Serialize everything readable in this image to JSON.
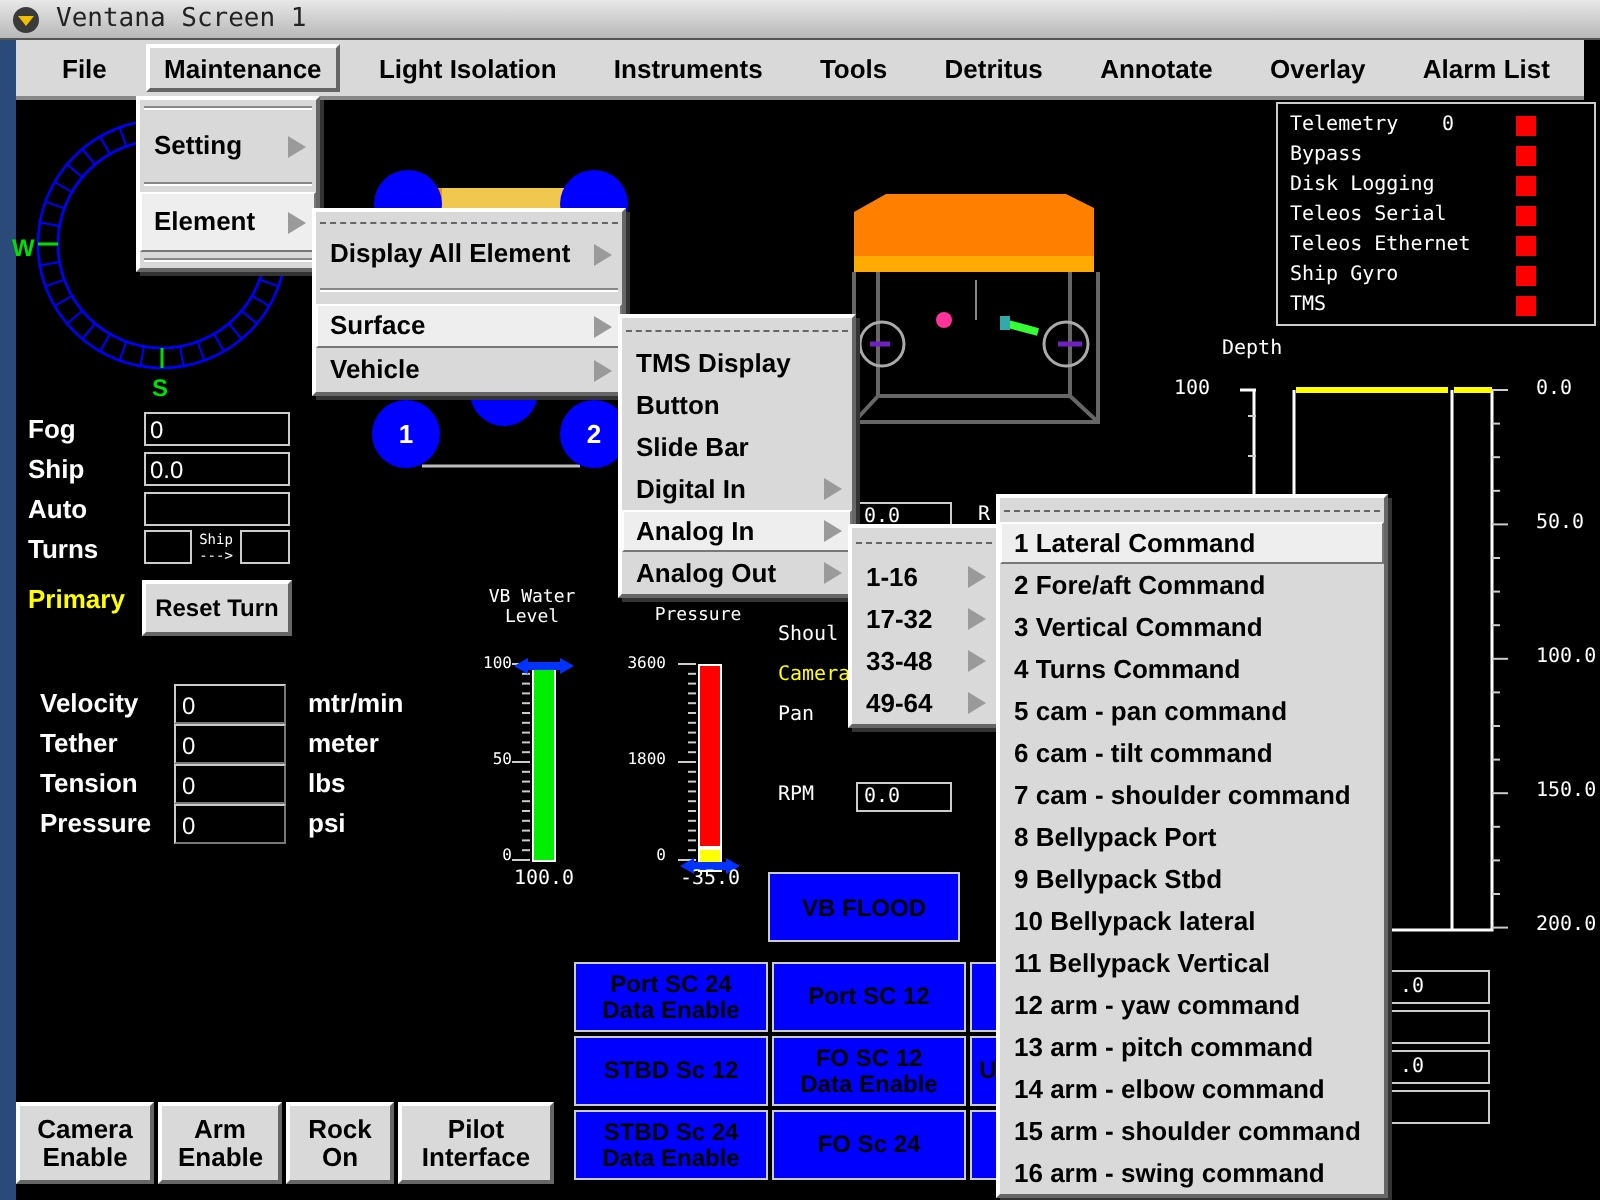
{
  "window": {
    "title": "Ventana Screen 1"
  },
  "menu_bar": [
    {
      "label": "File",
      "selected": false
    },
    {
      "label": "Maintenance",
      "selected": true
    },
    {
      "label": "Light Isolation",
      "selected": false
    },
    {
      "label": "Instruments",
      "selected": false
    },
    {
      "label": "Tools",
      "selected": false
    },
    {
      "label": "Detritus",
      "selected": false
    },
    {
      "label": "Annotate",
      "selected": false
    },
    {
      "label": "Overlay",
      "selected": false
    },
    {
      "label": "Alarm List",
      "selected": false
    }
  ],
  "compass": {
    "labels": [
      "W",
      "S"
    ]
  },
  "controls": [
    {
      "label": "Fog",
      "value": "0"
    },
    {
      "label": "Ship",
      "value": "0.0"
    },
    {
      "label": "Auto"
    }
  ],
  "turns": {
    "label": "Turns",
    "arrow_lines": [
      "Ship",
      "--->"
    ]
  },
  "primary": "Primary",
  "reset_button": "Reset Turn",
  "readouts": [
    {
      "label": "Velocity",
      "value": "0",
      "unit": "mtr/min"
    },
    {
      "label": "Tether",
      "value": "0",
      "unit": "meter"
    },
    {
      "label": "Tension",
      "value": "0",
      "unit": "lbs"
    },
    {
      "label": "Pressure",
      "value": "0",
      "unit": "psi"
    }
  ],
  "bottom_buttons": [
    "Camera Enable",
    "Arm Enable",
    "Rock On",
    "Pilot Interface"
  ],
  "thrusters": [
    "1",
    "2"
  ],
  "gauges": [
    {
      "title": "VB Water Level",
      "ticks": [
        "100",
        "50",
        "0"
      ],
      "reading": "100.0",
      "level": 1.0
    },
    {
      "title": "Pressure",
      "ticks": [
        "3600",
        "1800",
        "0"
      ],
      "reading": "-35.0",
      "level": 1.0
    }
  ],
  "vehicle_panel": {
    "labels": [
      {
        "text": "R",
        "highlight": false
      },
      {
        "text": "Shoul",
        "highlight": false
      },
      {
        "text": "Camera",
        "highlight": true
      },
      {
        "text": "Pan",
        "highlight": false
      },
      {
        "text": "RPM",
        "highlight": false
      }
    ],
    "fields": [
      "0.0",
      "0.0"
    ]
  },
  "vb_flood": "VB FLOOD",
  "sc_buttons": [
    {
      "kind": "labeled",
      "label": "Port SC 24 Data Enable"
    },
    {
      "kind": "labeled",
      "label": "Port SC 12"
    },
    {
      "kind": "blank"
    },
    {
      "kind": "labeled",
      "label": "STBD Sc 12"
    },
    {
      "kind": "labeled",
      "label": "FO SC 12 Data Enable"
    },
    {
      "kind": "labeled",
      "label": "U"
    },
    {
      "kind": "labeled",
      "label": "STBD Sc 24 Data Enable"
    },
    {
      "kind": "labeled",
      "label": "FO Sc 24"
    },
    {
      "kind": "blank"
    }
  ],
  "alarms": [
    {
      "label": "Telemetry",
      "value": "0",
      "color": "#ff0000"
    },
    {
      "label": "Bypass",
      "color": "#ff0000"
    },
    {
      "label": "Disk Logging",
      "color": "#ff0000"
    },
    {
      "label": "Teleos Serial",
      "color": "#ff0000"
    },
    {
      "label": "Teleos Ethernet",
      "color": "#ff0000"
    },
    {
      "label": "Ship Gyro",
      "color": "#ff0000"
    },
    {
      "label": "TMS",
      "color": "#ff0000"
    }
  ],
  "depth_gauge": {
    "title": "Depth",
    "top_label": "100",
    "scale": [
      "0.0",
      "50.0",
      "100.0",
      "150.0",
      "200.0"
    ]
  },
  "side_fields": [
    {
      "kind": "filled",
      "value": ".0"
    },
    {
      "kind": "blank"
    },
    {
      "kind": "filled",
      "value": ".0"
    },
    {
      "kind": "blank"
    }
  ],
  "menus": [
    {
      "items": [
        {
          "kind": "separator"
        },
        {
          "kind": "submenu",
          "label": "Setting",
          "selected": false
        },
        {
          "kind": "separator"
        },
        {
          "kind": "submenu",
          "label": "Element",
          "selected": true
        },
        {
          "kind": "separator"
        }
      ]
    },
    {
      "items": [
        {
          "kind": "tearoff"
        },
        {
          "kind": "submenu",
          "label": "Display All Element",
          "selected": false
        },
        {
          "kind": "separator"
        },
        {
          "kind": "submenu",
          "label": "Surface",
          "selected": true
        },
        {
          "kind": "submenu",
          "label": "Vehicle",
          "selected": false
        }
      ]
    },
    {
      "items": [
        {
          "kind": "tearoff"
        },
        {
          "kind": "command",
          "label": "TMS Display",
          "selected": false
        },
        {
          "kind": "command",
          "label": "Button",
          "selected": false
        },
        {
          "kind": "command",
          "label": "Slide Bar",
          "selected": false
        },
        {
          "kind": "submenu",
          "label": "Digital In",
          "selected": false
        },
        {
          "kind": "submenu",
          "label": "Analog In",
          "selected": true
        },
        {
          "kind": "submenu",
          "label": "Analog Out",
          "selected": false
        }
      ]
    },
    {
      "items": [
        {
          "kind": "tearoff"
        },
        {
          "kind": "submenu",
          "label": "1-16",
          "selected": false
        },
        {
          "kind": "submenu",
          "label": "17-32",
          "selected": false
        },
        {
          "kind": "submenu",
          "label": "33-48",
          "selected": false
        },
        {
          "kind": "submenu",
          "label": "49-64",
          "selected": false
        }
      ]
    },
    {
      "items": [
        {
          "kind": "tearoff"
        },
        {
          "kind": "command",
          "label": "1 Lateral Command",
          "selected": true
        },
        {
          "kind": "command",
          "label": "2 Fore/aft Command",
          "selected": false
        },
        {
          "kind": "command",
          "label": "3 Vertical Command",
          "selected": false
        },
        {
          "kind": "command",
          "label": "4 Turns Command",
          "selected": false
        },
        {
          "kind": "command",
          "label": "5 cam - pan command",
          "selected": false
        },
        {
          "kind": "command",
          "label": "6 cam - tilt command",
          "selected": false
        },
        {
          "kind": "command",
          "label": "7 cam - shoulder command",
          "selected": false
        },
        {
          "kind": "command",
          "label": "8 Bellypack Port",
          "selected": false
        },
        {
          "kind": "command",
          "label": "9 Bellypack Stbd",
          "selected": false
        },
        {
          "kind": "command",
          "label": "10 Bellypack lateral",
          "selected": false
        },
        {
          "kind": "command",
          "label": "11 Bellypack Vertical",
          "selected": false
        },
        {
          "kind": "command",
          "label": "12 arm - yaw command",
          "selected": false
        },
        {
          "kind": "command",
          "label": "13 arm - pitch command",
          "selected": false
        },
        {
          "kind": "command",
          "label": "14 arm - elbow command",
          "selected": false
        },
        {
          "kind": "command",
          "label": "15 arm - shoulder command",
          "selected": false
        },
        {
          "kind": "command",
          "label": "16 arm - swing command",
          "selected": false
        }
      ]
    }
  ]
}
